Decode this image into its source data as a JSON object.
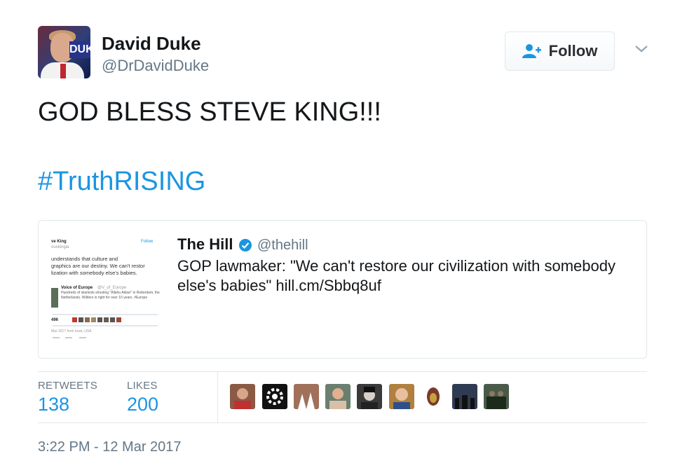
{
  "author": {
    "name": "David Duke",
    "handle": "@DrDavidDuke",
    "avatar_sign_text": "DUK"
  },
  "follow_button": {
    "label": "Follow"
  },
  "tweet": {
    "text": "GOD BLESS STEVE KING!!!",
    "hashtag": "#TruthRISING"
  },
  "quoted_tweet": {
    "name": "The Hill",
    "handle": "@thehill",
    "text": "GOP lawmaker: \"We can't restore our civilization with somebody else's babies\" hill.cm/Sbbq8uf",
    "thumbnail": {
      "author": "ve King",
      "author_handle": "ouskingia",
      "follow": "Follow",
      "text_lines": [
        "understands that culture and",
        "graphics are our destiny. We can't restor",
        "lization with somebody else's babies."
      ],
      "embedded_name": "Voice of Europe",
      "embedded_handle": "@V_of_Europe",
      "embedded_text": [
        "Hundreds of islamists shouting \"Allahu Akbar\" in Rotterdam, the",
        "Netherlands. Wilders is right for over 10 years. #Europe"
      ],
      "likes": "496",
      "footer": "Mar 2017 from Iowa, USA"
    }
  },
  "stats": {
    "retweets_label": "RETWEETS",
    "retweets_value": "138",
    "likes_label": "LIKES",
    "likes_value": "200"
  },
  "likers": [
    {
      "name": "liker-1",
      "color": "#8a5a44"
    },
    {
      "name": "liker-2",
      "color": "#111111"
    },
    {
      "name": "liker-3",
      "color": "#a0705a"
    },
    {
      "name": "liker-4",
      "color": "#6b7f70"
    },
    {
      "name": "liker-5",
      "color": "#3a3a3a"
    },
    {
      "name": "liker-6",
      "color": "#b08040"
    },
    {
      "name": "liker-7",
      "color": "#ffffff"
    },
    {
      "name": "liker-8",
      "color": "#2f3b52"
    },
    {
      "name": "liker-9",
      "color": "#4a5a48"
    }
  ],
  "timestamp": "3:22 PM - 12 Mar 2017",
  "colors": {
    "link": "#1b95e0",
    "muted": "#657786",
    "text": "#14171a",
    "border": "#e1e8ed"
  },
  "icons": {
    "follow": "add-user-icon",
    "caret": "chevron-down-icon",
    "verified": "verified-badge-icon"
  }
}
